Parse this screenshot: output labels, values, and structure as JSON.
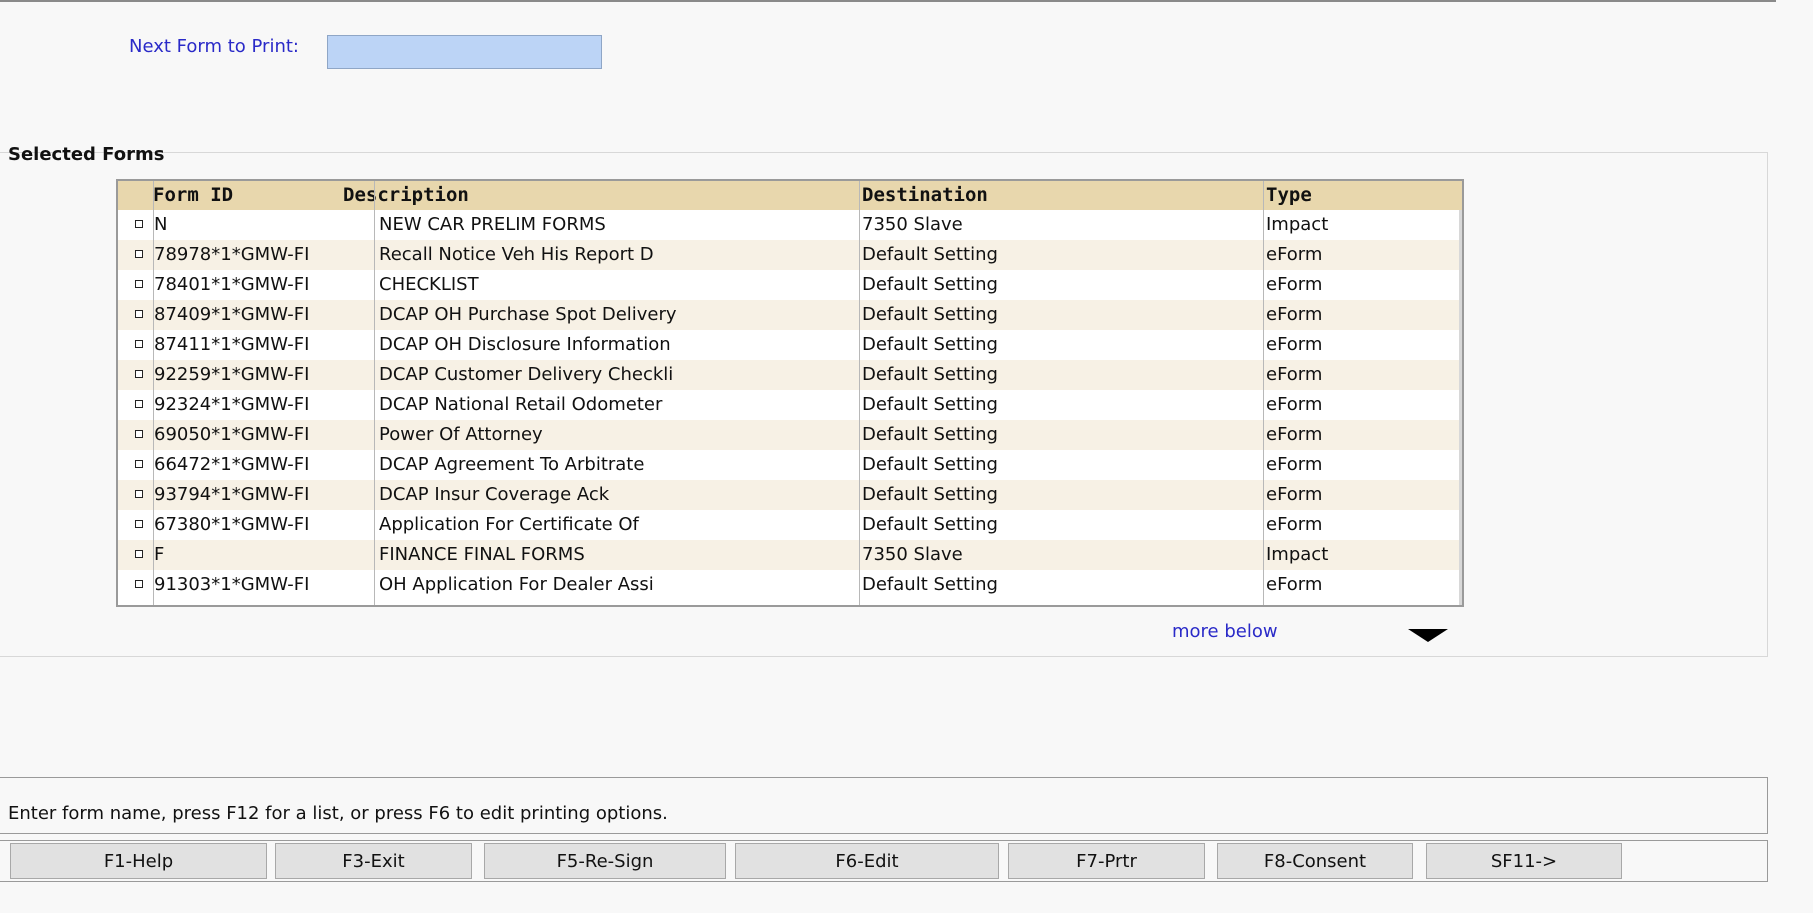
{
  "next_form": {
    "label": "Next Form to Print:",
    "value": ""
  },
  "section_title": "Selected Forms",
  "table": {
    "headers": [
      "Form ID",
      "Description",
      "Destination",
      "Type"
    ],
    "rows": [
      [
        "N",
        "NEW CAR PRELIM FORMS",
        "7350 Slave",
        "Impact"
      ],
      [
        "78978*1*GMW-FI",
        "Recall Notice Veh His Report D",
        "Default Setting",
        "eForm"
      ],
      [
        "78401*1*GMW-FI",
        "CHECKLIST",
        "Default Setting",
        "eForm"
      ],
      [
        "87409*1*GMW-FI",
        "DCAP OH Purchase Spot Delivery",
        "Default Setting",
        "eForm"
      ],
      [
        "87411*1*GMW-FI",
        "DCAP OH Disclosure Information",
        "Default Setting",
        "eForm"
      ],
      [
        "92259*1*GMW-FI",
        "DCAP Customer Delivery Checkli",
        "Default Setting",
        "eForm"
      ],
      [
        "92324*1*GMW-FI",
        "DCAP National Retail Odometer",
        "Default Setting",
        "eForm"
      ],
      [
        "69050*1*GMW-FI",
        "Power Of Attorney",
        "Default Setting",
        "eForm"
      ],
      [
        "66472*1*GMW-FI",
        "DCAP Agreement To Arbitrate",
        "Default Setting",
        "eForm"
      ],
      [
        "93794*1*GMW-FI",
        "DCAP Insur Coverage Ack",
        "Default Setting",
        "eForm"
      ],
      [
        "67380*1*GMW-FI",
        "Application For Certificate Of",
        "Default Setting",
        "eForm"
      ],
      [
        "F",
        "FINANCE FINAL FORMS",
        "7350 Slave",
        "Impact"
      ],
      [
        "91303*1*GMW-FI",
        "OH Application For Dealer Assi",
        "Default Setting",
        "eForm"
      ]
    ]
  },
  "more_below": "more below",
  "message": "Enter form name, press F12 for a list, or press F6 to edit printing options.",
  "function_keys": [
    "F1-Help",
    "F3-Exit",
    "F5-Re-Sign",
    "F6-Edit",
    "F7-Prtr",
    "F8-Consent",
    "SF11->"
  ],
  "icons": {
    "more_below": "down-triangle-icon",
    "checkbox": "checkbox-icon"
  },
  "colors": {
    "link_text": "#2a2ac8",
    "input_background": "#bcd4f6",
    "table_header": "#e8d7ad",
    "row_alt": "#f7f1e5"
  }
}
